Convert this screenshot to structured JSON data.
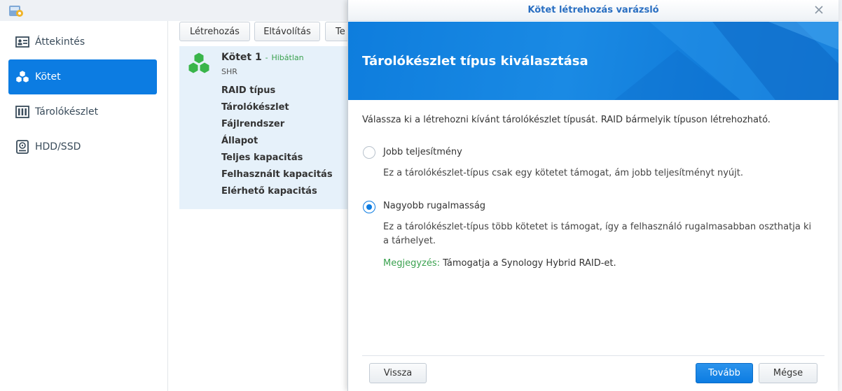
{
  "sidebar": {
    "items": [
      {
        "label": "Áttekintés",
        "icon": "overview-icon",
        "active": false
      },
      {
        "label": "Kötet",
        "icon": "volume-cubes-icon",
        "active": true
      },
      {
        "label": "Tárolókészlet",
        "icon": "storage-pool-icon",
        "active": false
      },
      {
        "label": "HDD/SSD",
        "icon": "hdd-icon",
        "active": false
      }
    ]
  },
  "toolbar": {
    "create_label": "Létrehozás",
    "remove_label": "Eltávolítás",
    "more_label": "Te"
  },
  "volume": {
    "name": "Kötet 1",
    "status_separator": "-",
    "status": "Hibátlan",
    "type": "SHR",
    "properties": [
      "RAID típus",
      "Tárolókészlet",
      "Fájlrendszer",
      "Állapot",
      "Teljes kapacitás",
      "Felhasznált kapacitás",
      "Elérhető kapacitás"
    ]
  },
  "wizard": {
    "title": "Kötet létrehozás varázsló",
    "heading": "Tárolókészlet típus kiválasztása",
    "description": "Válassza ki a létrehozni kívánt tárolókészlet típusát. RAID bármelyik típuson létrehozható.",
    "options": [
      {
        "label": "Jobb teljesítmény",
        "description": "Ez a tárolókészlet-típus csak egy kötetet támogat, ám jobb teljesítményt nyújt.",
        "selected": false
      },
      {
        "label": "Nagyobb rugalmasság",
        "description": "Ez a tárolókészlet-típus több kötetet is támogat, így a felhasználó rugalmasabban oszthatja ki a tárhelyet.",
        "selected": true
      }
    ],
    "note_label": "Megjegyzés:",
    "note_text": "Támogatja a Synology Hybrid RAID-et.",
    "back_label": "Vissza",
    "next_label": "Tovább",
    "cancel_label": "Mégse"
  },
  "colors": {
    "accent": "#0c7ce2",
    "status_ok": "#3aa14f",
    "volume_green": "#39b54a"
  }
}
